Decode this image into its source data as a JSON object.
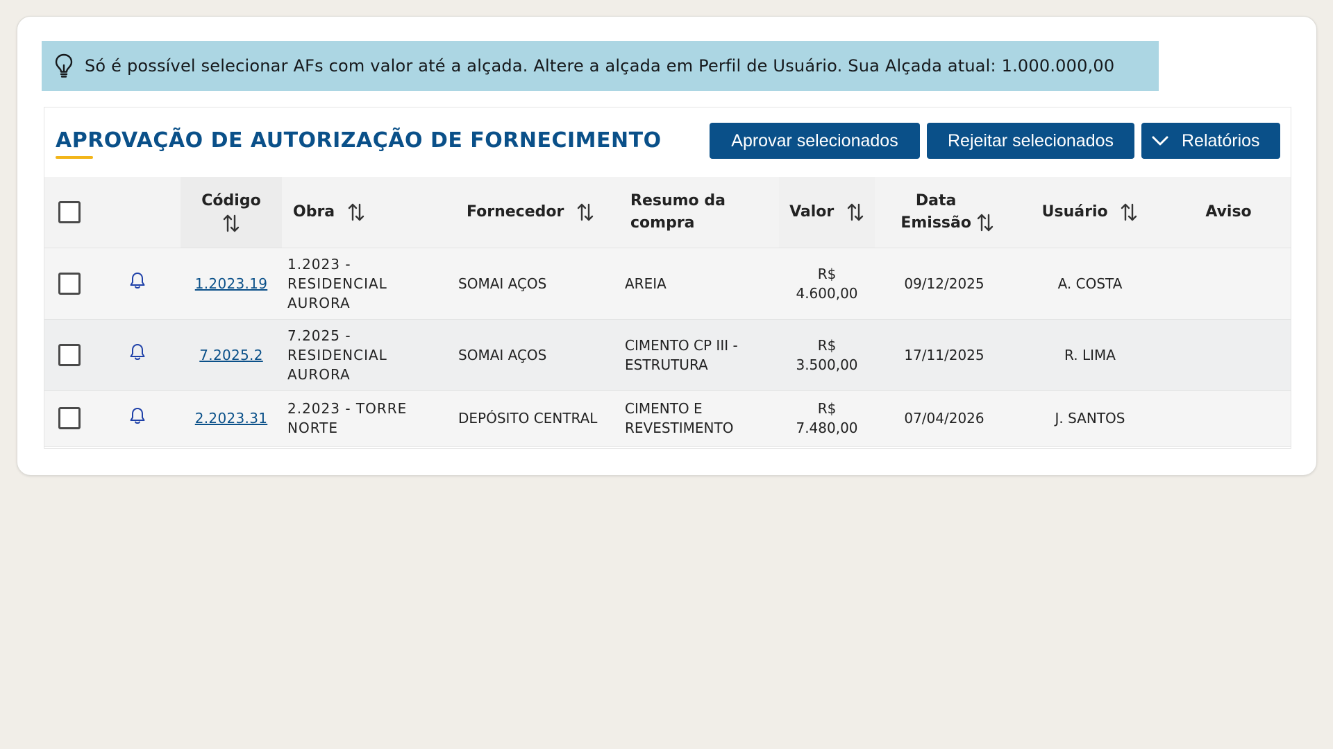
{
  "alert": {
    "icon": "lightbulb-icon",
    "text": "Só é possível selecionar AFs com valor até a alçada. Altere a alçada em Perfil de Usuário. Sua Alçada atual: 1.000.000,00",
    "background": "#acd6e3"
  },
  "header": {
    "title": "APROVAÇÃO DE AUTORIZAÇÃO DE FORNECIMENTO",
    "accent": "#f2b51a",
    "title_color": "#0a5089"
  },
  "actions": {
    "approve_label": "Aprovar selecionados",
    "reject_label": "Rejeitar selecionados",
    "reports_label": "Relatórios",
    "button_color": "#0a5089"
  },
  "table": {
    "columns": {
      "codigo": "Código",
      "obra": "Obra",
      "fornecedor": "Fornecedor",
      "resumo": "Resumo da compra",
      "valor": "Valor",
      "data": "Data Emissão",
      "usuario": "Usuário",
      "aviso": "Aviso"
    },
    "rows": [
      {
        "codigo": "1.2023.19",
        "obra": "1.2023 - RESIDENCIAL AURORA",
        "fornecedor": "SOMAI AÇOS",
        "resumo": "AREIA",
        "valor": "R$ 4.600,00",
        "data": "09/12/2025",
        "usuario": "A. COSTA",
        "aviso": ""
      },
      {
        "codigo": "7.2025.2",
        "obra": "7.2025 - RESIDENCIAL AURORA",
        "fornecedor": "SOMAI AÇOS",
        "resumo": "CIMENTO CP III - ESTRUTURA",
        "valor": "R$ 3.500,00",
        "data": "17/11/2025",
        "usuario": "R. LIMA",
        "aviso": ""
      },
      {
        "codigo": "2.2023.31",
        "obra": "2.2023 - TORRE NORTE",
        "fornecedor": "DEPÓSITO CENTRAL",
        "resumo": "CIMENTO E REVESTIMENTO",
        "valor": "R$ 7.480,00",
        "data": "07/04/2026",
        "usuario": "J. SANTOS",
        "aviso": ""
      }
    ]
  }
}
